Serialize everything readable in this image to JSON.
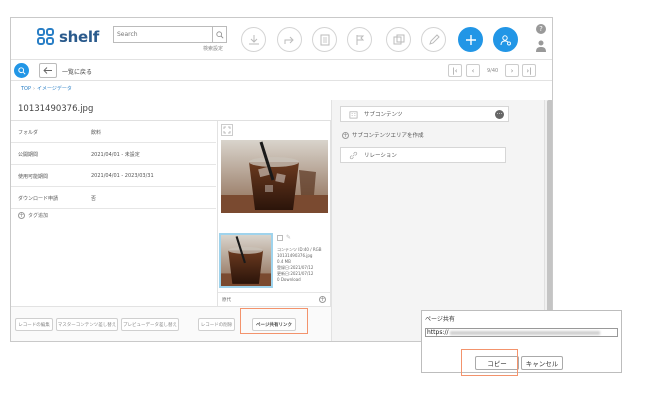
{
  "header": {
    "logo_text": "shelf",
    "search_placeholder": "Search",
    "advanced_search": "検索設定",
    "help_label": "?"
  },
  "toolbar": {
    "back_label": "一覧に戻る",
    "page_count": "9/40"
  },
  "breadcrumb": {
    "root": "TOP",
    "current": "イメージデータ"
  },
  "file": {
    "title": "10131490376.jpg"
  },
  "properties": [
    {
      "label": "フォルダ",
      "value": "飲料"
    },
    {
      "label": "公開期間",
      "value": "2021/04/01 - 未設定"
    },
    {
      "label": "使用可能期間",
      "value": "2021/04/01 - 2023/03/31"
    },
    {
      "label": "ダウンロード申請",
      "value": "否"
    }
  ],
  "tag_add_label": "タグ追加",
  "thumbnail": {
    "meta": [
      "コンテンツ ID:40 / RGB",
      "10131490376.jpg",
      "0.4 MB",
      "登録日:2021/07/12",
      "更新日:2021/07/12",
      "0 Download"
    ],
    "footer_label": "原代"
  },
  "right_panel": {
    "sub_content_label": "サブコンテンツ",
    "create_sub_label": "サブコンテンツエリアを作成",
    "relation_label": "リレーション"
  },
  "footer_buttons": {
    "edit_record": "レコードの編集",
    "replace_master": "マスターコンテンツ差し替え",
    "replace_preview": "プレビューデータ差し替え",
    "delete_record": "レコードの削除",
    "share_link": "ページ共有リンク"
  },
  "dialog": {
    "title": "ページ共有",
    "url_prefix": "https://",
    "copy_label": "コピー",
    "cancel_label": "キャンセル"
  },
  "colors": {
    "accent": "#2296e6",
    "highlight": "#f3936c",
    "logo": "#2a5a8c"
  }
}
